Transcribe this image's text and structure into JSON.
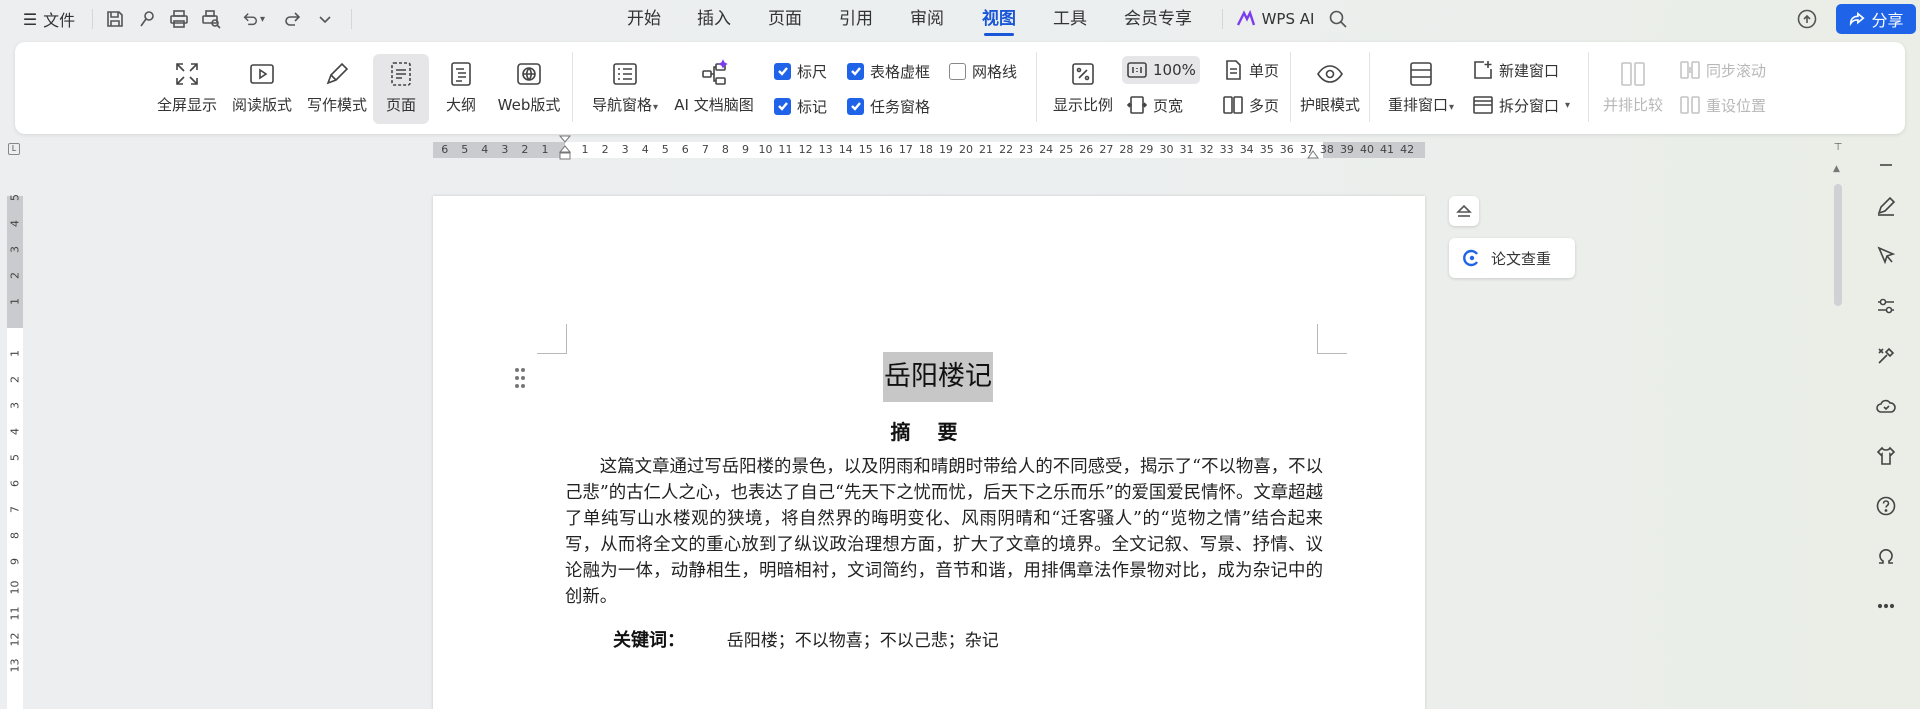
{
  "topbar": {
    "file_label": "文件",
    "tabs": [
      "开始",
      "插入",
      "页面",
      "引用",
      "审阅",
      "视图",
      "工具",
      "会员专享"
    ],
    "active_tab": "视图",
    "ai_label": "WPS AI",
    "share_label": "分享",
    "accent_color": "#1f64e8"
  },
  "ribbon": {
    "view_modes": [
      "全屏显示",
      "阅读版式",
      "写作模式",
      "页面",
      "大纲",
      "Web版式"
    ],
    "selected_view_mode": "页面",
    "nav_pane_label": "导航窗格",
    "mindmap_label": "AI 文档脑图",
    "checkboxes": [
      {
        "label": "标尺",
        "checked": true
      },
      {
        "label": "表格虚框",
        "checked": true
      },
      {
        "label": "网格线",
        "checked": false
      },
      {
        "label": "标记",
        "checked": true
      },
      {
        "label": "任务窗格",
        "checked": true
      }
    ],
    "zoom_label": "显示比例",
    "zoom_value": "100%",
    "page_width_label": "页宽",
    "single_page_label": "单页",
    "multi_page_label": "多页",
    "eye_mode_label": "护眼模式",
    "arrange_label": "重排窗口",
    "new_window_label": "新建窗口",
    "split_label": "拆分窗口",
    "compare_label": "并排比较",
    "sync_scroll_label": "同步滚动",
    "reset_pos_label": "重设位置"
  },
  "ruler": {
    "left_numbers": [
      "6",
      "5",
      "4",
      "3",
      "2",
      "1"
    ],
    "right_numbers": [
      "1",
      "2",
      "3",
      "4",
      "5",
      "6",
      "7",
      "8",
      "9",
      "10",
      "11",
      "12",
      "13",
      "14",
      "15",
      "16",
      "17",
      "18",
      "19",
      "20",
      "21",
      "22",
      "23",
      "24",
      "25",
      "26",
      "27",
      "28",
      "29",
      "30",
      "31",
      "32",
      "33",
      "34",
      "35",
      "36",
      "37",
      "38",
      "39",
      "40",
      "41",
      "42"
    ],
    "v_top_numbers": [
      "5",
      "4",
      "3",
      "2",
      "1"
    ],
    "v_bottom_numbers": [
      "1",
      "2",
      "3",
      "4",
      "5",
      "6",
      "7",
      "8",
      "9",
      "10",
      "11",
      "12",
      "13"
    ]
  },
  "document": {
    "title": "岳阳楼记",
    "abstract_heading": "摘 要",
    "abstract": "这篇文章通过写岳阳楼的景色，以及阴雨和晴朗时带给人的不同感受，揭示了“不以物喜，不以己悲”的古仁人之心，也表达了自己“先天下之忧而忧，后天下之乐而乐”的爱国爱民情怀。文章超越了单纯写山水楼观的狭境，将自然界的晦明变化、风雨阴晴和“迁客骚人”的“览物之情”结合起来写，从而将全文的重心放到了纵议政治理想方面，扩大了文章的境界。全文记叙、写景、抒情、议论融为一体，动静相生，明暗相衬，文词简约，音节和谐，用排偶章法作景物对比，成为杂记中的创新。",
    "keywords_label": "关键词：",
    "keywords": "岳阳楼；不以物喜；不以己悲；杂记"
  },
  "side": {
    "paper_check_label": "论文查重"
  }
}
